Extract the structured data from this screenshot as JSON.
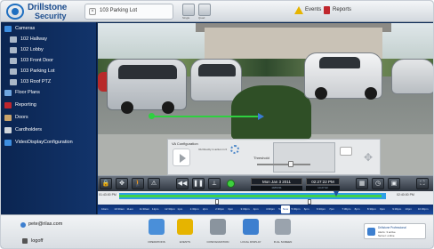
{
  "app": {
    "brand_name": "Drillstone",
    "brand_sub": "Security"
  },
  "topbar": {
    "camera_tab_label": "103 Parking Lot",
    "toolbar_buttons": [
      {
        "icon": "layout-icon",
        "label": "Single"
      },
      {
        "icon": "grid-icon",
        "label": "Quad"
      }
    ],
    "events_label": "Events",
    "reports_label": "Reports"
  },
  "sidebar": {
    "items": [
      {
        "label": "Cameras",
        "icon": "camera-icon",
        "level": 0
      },
      {
        "label": "102 Hallway",
        "icon": "camera-icon",
        "level": 1
      },
      {
        "label": "102 Lobby",
        "icon": "camera-icon",
        "level": 1
      },
      {
        "label": "103 Front Door",
        "icon": "camera-icon",
        "level": 1
      },
      {
        "label": "103 Parking Lot",
        "icon": "camera-icon",
        "level": 1
      },
      {
        "label": "103 Roof PTZ",
        "icon": "camera-icon",
        "level": 1
      },
      {
        "label": "Floor Plans",
        "icon": "floorplan-icon",
        "level": 0
      },
      {
        "label": "Reporting",
        "icon": "report-icon",
        "level": 0
      },
      {
        "label": "Doors",
        "icon": "door-icon",
        "level": 0
      },
      {
        "label": "Cardholders",
        "icon": "cardholder-icon",
        "level": 0
      },
      {
        "label": "VideoDisplayConfiguration",
        "icon": "display-icon",
        "level": 0
      }
    ]
  },
  "va_config": {
    "title": "VA Configuration",
    "description": "VA Directly in action in 0",
    "threshold_label": "Threshold"
  },
  "playback": {
    "date": "Mon Jan 3 2011",
    "time": "02:27:22 PM",
    "sub_date": "10/03/11",
    "sub_time": "14:27:22",
    "controls": [
      {
        "icon": "lock-icon",
        "glyph": "🔒"
      },
      {
        "icon": "pan-icon",
        "glyph": "✥"
      },
      {
        "icon": "walk-icon",
        "glyph": "🚶"
      },
      {
        "icon": "alert-icon",
        "glyph": "⚠"
      },
      {
        "icon": "rewind-icon",
        "glyph": "◀◀"
      },
      {
        "icon": "pause-icon",
        "glyph": "❚❚"
      },
      {
        "icon": "step-icon",
        "glyph": "⟂"
      },
      {
        "icon": "calendar-icon",
        "glyph": "▦"
      },
      {
        "icon": "clock-icon",
        "glyph": "◷"
      },
      {
        "icon": "save-icon",
        "glyph": "▣"
      },
      {
        "icon": "fullscreen-icon",
        "glyph": "⛶"
      }
    ]
  },
  "timeline": {
    "start_time": "01:43:00 PM",
    "end_time": "02:40:00 PM",
    "now_label": "Now",
    "ticks": [
      "10am",
      "10:30am",
      "11am",
      "11:30am",
      "12pm",
      "12:30pm",
      "1pm",
      "1:30pm",
      "2pm",
      "2:30pm",
      "3pm",
      "3:30pm",
      "4pm",
      "4:30pm",
      "5pm",
      "5:30pm",
      "6pm",
      "6:30pm",
      "7pm",
      "7:30pm",
      "8pm",
      "8:30pm",
      "9pm",
      "9:30pm",
      "10pm",
      "10:30pm"
    ]
  },
  "bottombar": {
    "user_label": "pete@rilas.com",
    "logoff_label": "logoff",
    "items": [
      {
        "label": "OPERATIONS",
        "icon": "operations-icon",
        "color": "#4a8fd9"
      },
      {
        "label": "EVENTS",
        "icon": "events-icon",
        "color": "#e6b400"
      },
      {
        "label": "CONFIGURATION",
        "icon": "configuration-icon",
        "color": "#8a949e"
      },
      {
        "label": "LOCAL DISPLAY",
        "icon": "local-display-icon",
        "color": "#3d7fcf"
      },
      {
        "label": "FULL SCREEN",
        "icon": "full-screen-icon",
        "color": "#9aa3ad"
      }
    ],
    "notice": {
      "title": "Drillstone Professional",
      "line1": "Alerts: 3 active",
      "line2": "Server: online"
    }
  },
  "colors": {
    "sidebar_bg": "#0b2551",
    "accent_blue": "#2e9fe6",
    "accent_green": "#3fd34a",
    "timeline_bg": "#0c2f70"
  }
}
